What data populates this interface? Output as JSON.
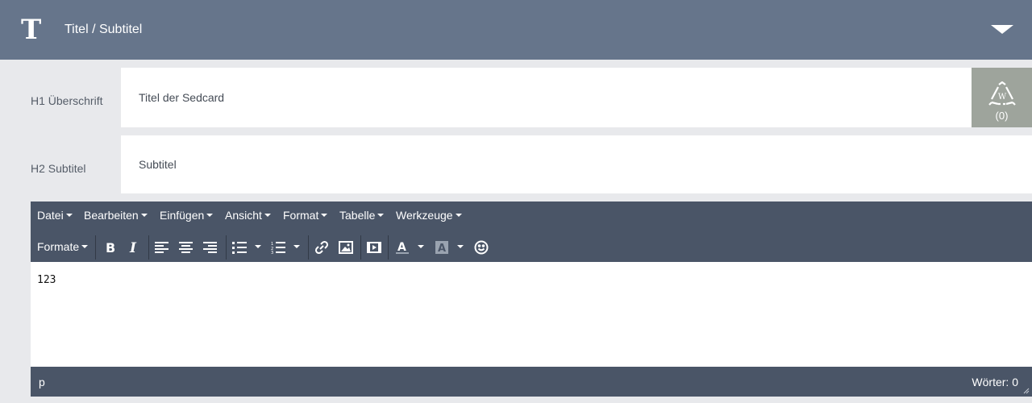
{
  "header": {
    "logo": "T",
    "title": "Titel / Subtitel"
  },
  "fields": {
    "h1": {
      "label": "H1 Überschrift",
      "value": "Titel der Sedcard"
    },
    "h2": {
      "label": "H2 Subtitel",
      "value": "Subtitel"
    }
  },
  "wbox": {
    "icon": "recycle-w-icon",
    "count": "(0)"
  },
  "editor": {
    "menu": [
      {
        "label": "Datei"
      },
      {
        "label": "Bearbeiten"
      },
      {
        "label": "Einfügen"
      },
      {
        "label": "Ansicht"
      },
      {
        "label": "Format"
      },
      {
        "label": "Tabelle"
      },
      {
        "label": "Werkzeuge"
      }
    ],
    "formats_label": "Formate",
    "content": "123",
    "path": "p",
    "word_count": "Wörter: 0"
  },
  "colors": {
    "header_bg": "#66758b",
    "editor_bg": "#4a5567",
    "page_bg": "#e8e9ec",
    "wbox_bg": "#9ea49c"
  }
}
